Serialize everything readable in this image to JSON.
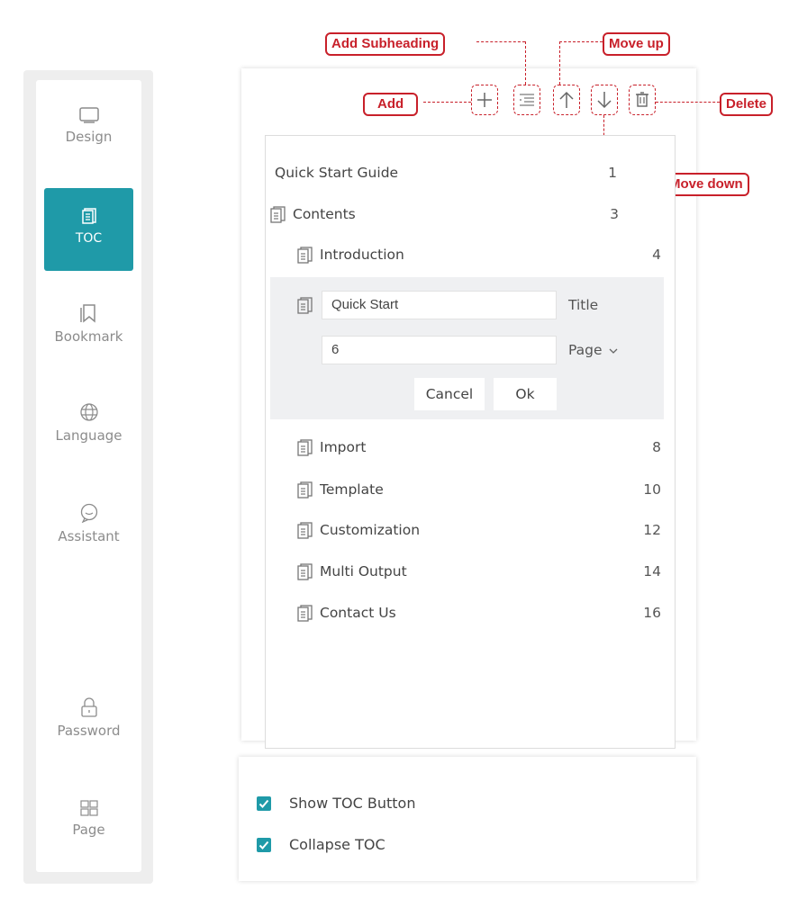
{
  "sidebar": {
    "items": [
      {
        "label": "Design",
        "icon": "monitor-icon"
      },
      {
        "label": "TOC",
        "icon": "toc-icon",
        "active": true
      },
      {
        "label": "Bookmark",
        "icon": "bookmark-icon"
      },
      {
        "label": "Language",
        "icon": "globe-icon"
      },
      {
        "label": "Assistant",
        "icon": "chat-icon"
      },
      {
        "label": "Password",
        "icon": "lock-icon"
      },
      {
        "label": "Page",
        "icon": "grid-icon"
      }
    ]
  },
  "toolbar": {
    "callouts": {
      "add": "Add",
      "add_subheading": "Add Subheading",
      "move_up": "Move up",
      "move_down": "Move down",
      "delete": "Delete"
    }
  },
  "toc": {
    "title": "Quick Start Guide",
    "title_page": "1",
    "contents": {
      "label": "Contents",
      "page": "3"
    },
    "items_before": [
      {
        "label": "Introduction",
        "page": "4"
      }
    ],
    "editing": {
      "title_value": "Quick Start",
      "title_label": "Title",
      "page_value": "6",
      "page_label": "Page",
      "cancel_label": "Cancel",
      "ok_label": "Ok"
    },
    "items_after": [
      {
        "label": "Import",
        "page": "8"
      },
      {
        "label": "Template",
        "page": "10"
      },
      {
        "label": "Customization",
        "page": "12"
      },
      {
        "label": "Multi Output",
        "page": "14"
      },
      {
        "label": "Contact Us",
        "page": "16"
      }
    ]
  },
  "options": {
    "show_toc_button": {
      "label": "Show TOC Button",
      "checked": true
    },
    "collapse_toc": {
      "label": "Collapse TOC",
      "checked": true
    }
  },
  "colors": {
    "accent": "#1f9aa8",
    "callout": "#c8202a"
  }
}
